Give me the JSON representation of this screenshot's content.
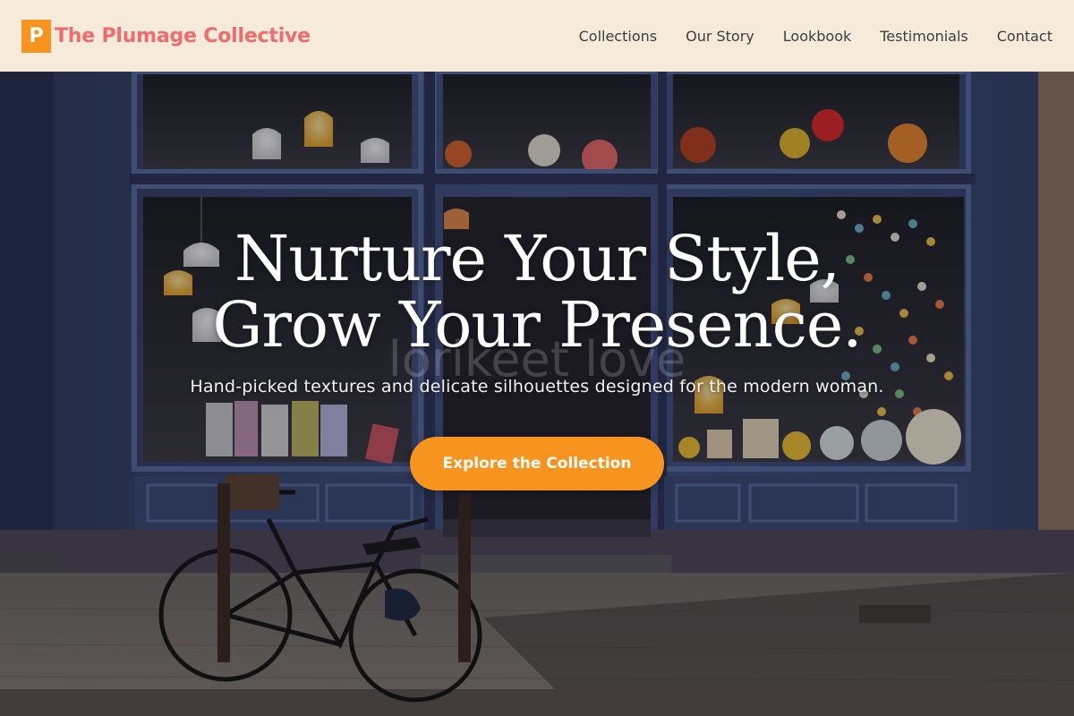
{
  "brand": {
    "mark": "P",
    "name": "The Plumage Collective"
  },
  "nav": {
    "items": [
      {
        "label": "Collections"
      },
      {
        "label": "Our Story"
      },
      {
        "label": "Lookbook"
      },
      {
        "label": "Testimonials"
      },
      {
        "label": "Contact"
      }
    ]
  },
  "hero": {
    "title_line1": "Nurture Your Style,",
    "title_line2": "Grow Your Presence.",
    "subtitle": "Hand-picked textures and delicate silhouettes designed for the modern woman.",
    "cta_label": "Explore the Collection",
    "window_lettering": "lorikeet love"
  },
  "colors": {
    "header_bg": "#f6eadb",
    "brand_text": "#f06c6c",
    "accent": "#f7941d",
    "nav_text": "#3d3d3d",
    "storefront": "#3a4770"
  }
}
